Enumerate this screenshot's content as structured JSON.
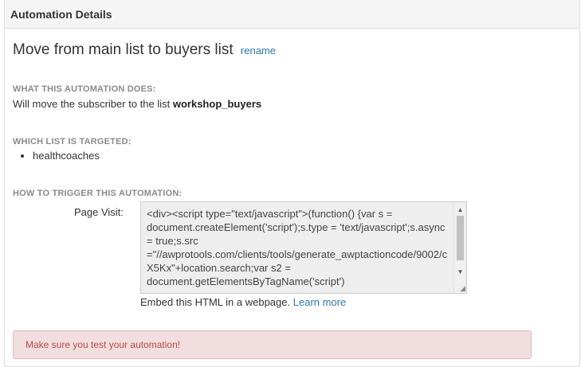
{
  "header": {
    "title": "Automation Details"
  },
  "automation": {
    "name": "Move from main list to buyers list",
    "rename_link": "rename"
  },
  "does": {
    "label": "WHAT THIS AUTOMATION DOES:",
    "text_prefix": "Will move the subscriber to the list",
    "list_name": "workshop_buyers"
  },
  "targeted": {
    "label": "WHICH LIST IS TARGETED:",
    "items": [
      "healthcoaches"
    ]
  },
  "trigger": {
    "label": "HOW TO TRIGGER THIS AUTOMATION:",
    "field_label": "Page Visit:",
    "code": "<div><script type=\"text/javascript\">(function() {var s = document.createElement('script');s.type = 'text/javascript';s.async = true;s.src =\"//awprotools.com/clients/tools/generate_awptactioncode/9002/cX5Kx\"+location.search;var s2 = document.getElementsByTagName('script')",
    "embed_text": "Embed this HTML in a webpage.",
    "learn_more": "Learn more"
  },
  "alert": {
    "text": "Make sure you test your automation!"
  }
}
